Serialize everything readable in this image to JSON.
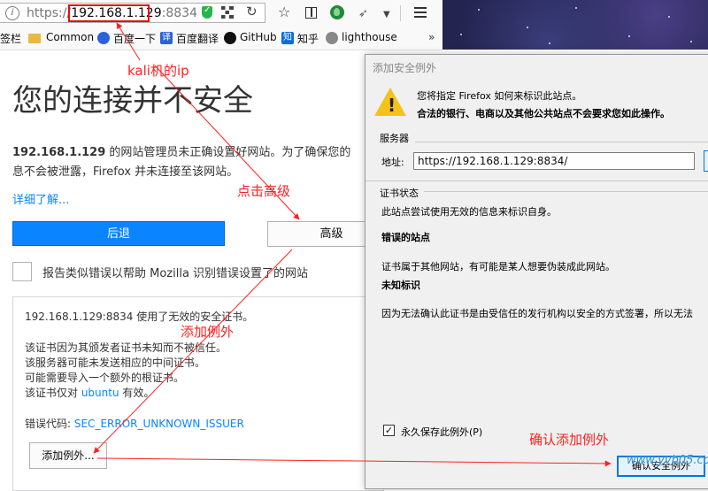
{
  "toolbar": {
    "url_scheme": "https://",
    "url_host": "192.168.1.129",
    "url_port": ":8834"
  },
  "bookmarks": {
    "items": [
      {
        "label": "签栏"
      },
      {
        "label": "Common"
      },
      {
        "label": "百度一下"
      },
      {
        "label": "百度翻译"
      },
      {
        "label": "GitHub"
      },
      {
        "label": "知乎"
      },
      {
        "label": "lighthouse"
      }
    ],
    "more": "»"
  },
  "error_page": {
    "title": "您的连接并不安全",
    "desc_host": "192.168.1.129",
    "desc_line1": " 的网站管理员未正确设置好网站。为了确保您的",
    "desc_line2": "息不会被泄露，Firefox 并未连接至该网站。",
    "learn_more": "详细了解...",
    "back_button": "后退",
    "advanced_button": "高级",
    "report_label": "报告类似错误以帮助 Mozilla 识别错误设置了的网站",
    "advanced": {
      "line1": "192.168.1.129:8834 使用了无效的安全证书。",
      "line2": "该证书因为其颁发者证书未知而不被信任。",
      "line3": "该服务器可能未发送相应的中间证书。",
      "line4": "可能需要导入一个额外的根证书。",
      "line5_prefix": "该证书仅对 ",
      "line5_link": "ubuntu",
      "line5_suffix": " 有效。",
      "error_code_label": "错误代码: ",
      "error_code": "SEC_ERROR_UNKNOWN_ISSUER",
      "add_exception_button": "添加例外..."
    }
  },
  "dialog": {
    "title": "添加安全例外",
    "warning_line1": "您将指定 Firefox 如何来标识此站点。",
    "warning_line2": "合法的银行、电商以及其他公共站点不会要求您如此操作。",
    "server_section": "服务器",
    "address_label": "地址:",
    "address_value": "https://192.168.1.129:8834/",
    "cert_status_section": "证书状态",
    "cert_status_text": "此站点尝试使用无效的信息来标识自身。",
    "wrong_site_heading": "错误的站点",
    "wrong_site_text": "证书属于其他网站，有可能是某人想要伪装成此网站。",
    "unknown_id_heading": "未知标识",
    "unknown_id_text": "因为无法确认此证书是由受信任的发行机构以安全的方式签署，所以无法",
    "permanent_label": "永久保存此例外(P)",
    "confirm_button": "确认安全例外"
  },
  "annotations": {
    "kali_ip": "kali机的ip",
    "click_advanced": "点击高级",
    "add_exception": "添加例外",
    "confirm_add": "确认添加例外",
    "color": "#ff2020"
  },
  "watermark": "www.yvb05.com"
}
